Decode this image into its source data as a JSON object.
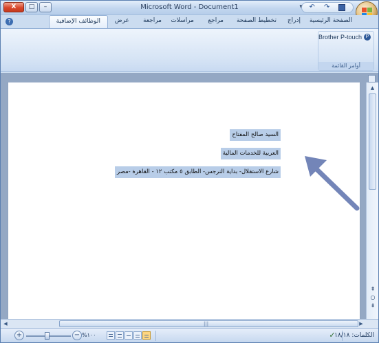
{
  "window": {
    "title": "Microsoft Word - Document1",
    "controls": {
      "minimize": "–",
      "maximize": "□",
      "close": "X"
    }
  },
  "quick_access": {
    "undo": "↶",
    "redo": "↷",
    "save": "save-icon",
    "dropdown": "▾"
  },
  "tabs": [
    {
      "label": "الصفحة الرئيسية",
      "active": false
    },
    {
      "label": "إدراج",
      "active": false
    },
    {
      "label": "تخطيط الصفحة",
      "active": false
    },
    {
      "label": "مراجع",
      "active": false
    },
    {
      "label": "مراسلات",
      "active": false
    },
    {
      "label": "مراجعة",
      "active": false
    },
    {
      "label": "عرض",
      "active": false
    },
    {
      "label": "الوظائف الإضافية",
      "active": true
    }
  ],
  "ribbon": {
    "addin_button": "Brother P-touch",
    "group_label": "أوامر القائمة"
  },
  "document": {
    "lines": [
      "السيد صالح المفتاح",
      "العربية للخدمات المالية",
      "شارع الاستقلال- بداية النرجس- الطابق ٥ مكتب ١٢ - القاهرة -مصر"
    ],
    "selection_color": "#b8cde8",
    "arrow_color": "#7385b8"
  },
  "statusbar": {
    "words": "الكلمات: ١٨/١٨",
    "zoom": "%١٠٠",
    "zoom_minus": "−",
    "zoom_plus": "+"
  },
  "colors": {
    "frame": "#cfdff1",
    "title_gradient_top": "#e3eefb",
    "page_background": "#94a8c4",
    "active_view": "#ffd680"
  }
}
